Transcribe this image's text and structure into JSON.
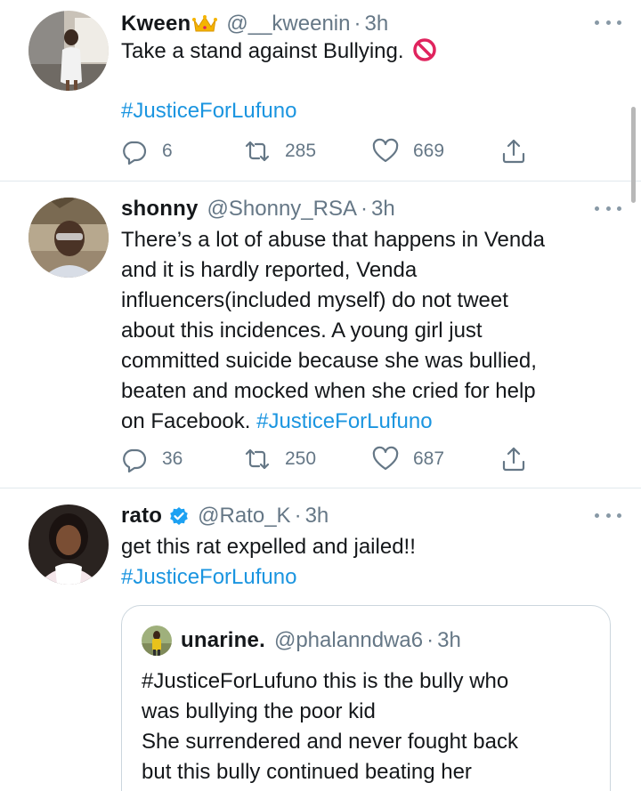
{
  "tweets": [
    {
      "name": "Kween",
      "handle": "@__kweenin",
      "time": "3h",
      "text": "Take a stand against Bullying.",
      "hashtag": "#JusticeForLufuno",
      "replies": "6",
      "retweets": "285",
      "likes": "669"
    },
    {
      "name": "shonny",
      "handle": "@Shonny_RSA",
      "time": "3h",
      "text_lines": [
        "There’s a lot of abuse that happens in Venda",
        "and it is hardly reported, Venda",
        "influencers(included myself) do not tweet",
        "about this incidences. A young girl just",
        "committed suicide because she was bullied,",
        "beaten and mocked when she cried for help",
        "on Facebook."
      ],
      "hashtag": "#JusticeForLufuno",
      "replies": "36",
      "retweets": "250",
      "likes": "687"
    },
    {
      "name": "rato",
      "handle": "@Rato_K",
      "time": "3h",
      "text": "get this rat expelled and jailed!!",
      "hashtag": "#JusticeForLufuno",
      "quote": {
        "name": "unarine.",
        "handle": "@phalanndwa6",
        "time": "3h",
        "lines": [
          "#JusticeForLufuno this is the bully who",
          "was bullying the poor kid",
          "She surrendered and never fought back",
          "but this bully continued beating her"
        ]
      }
    }
  ],
  "separator": "·",
  "icons": {
    "reply": "reply-icon",
    "retweet": "retweet-icon",
    "like": "heart-icon",
    "share": "share-icon",
    "more": "more-icon",
    "verified": "verified-badge-icon",
    "crown": "crown-emoji-icon",
    "no_entry": "no-entry-emoji-icon"
  },
  "colors": {
    "text": "#14171a",
    "secondary": "#657786",
    "link": "#1b95e0",
    "divider": "#e1e8ed"
  }
}
